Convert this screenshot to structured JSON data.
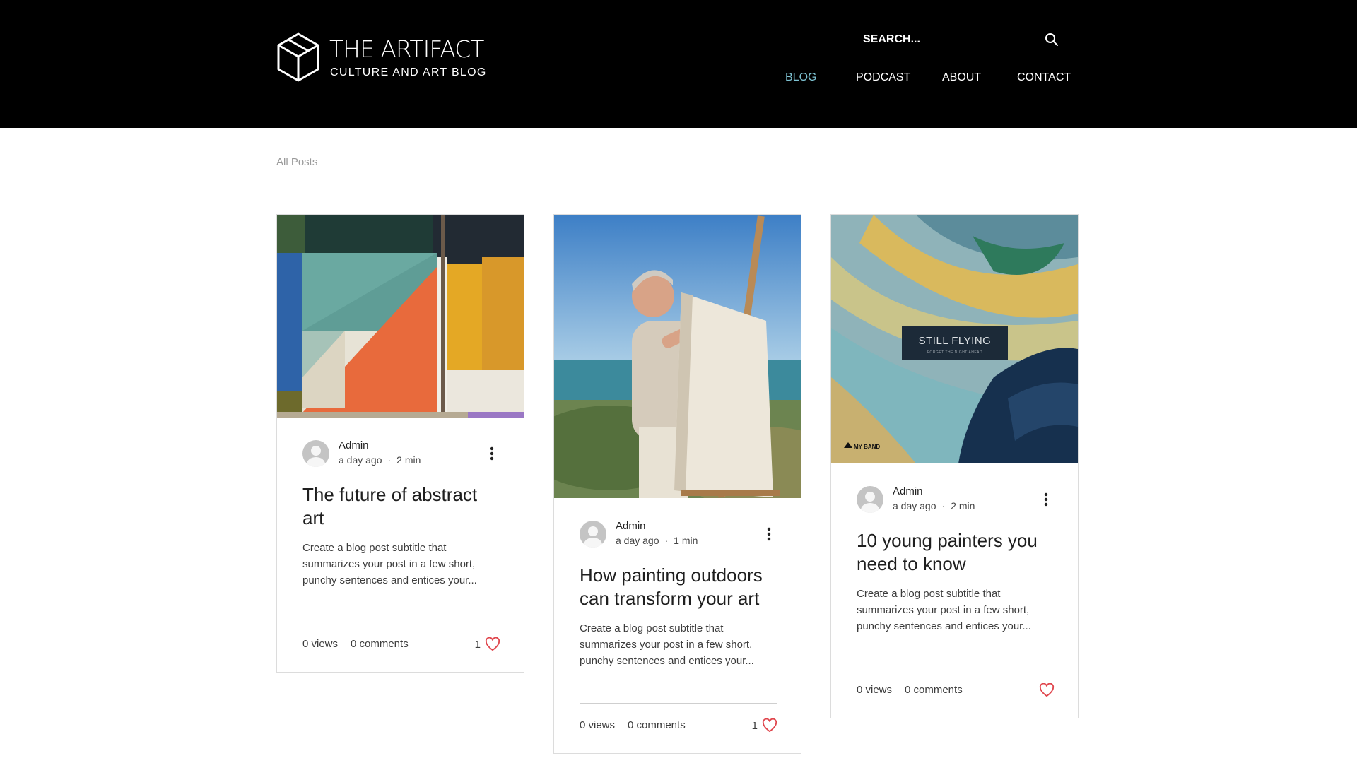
{
  "site": {
    "title": "THE ARTIFACT",
    "subtitle": "CULTURE AND ART BLOG",
    "logo_icon": "hexagon-cube-icon"
  },
  "search": {
    "placeholder": "SEARCH...",
    "icon": "search-icon"
  },
  "nav": {
    "items": [
      {
        "label": "BLOG",
        "active": true
      },
      {
        "label": "PODCAST",
        "active": false
      },
      {
        "label": "ABOUT",
        "active": false
      },
      {
        "label": "CONTACT",
        "active": false
      }
    ]
  },
  "breadcrumb": {
    "all_posts": "All Posts"
  },
  "posts": [
    {
      "author": "Admin",
      "time": "a day ago",
      "read_time": "2 min",
      "title": "The future of abstract art",
      "excerpt": "Create a blog post subtitle that summarizes your post in a few short, punchy sentences and entices your...",
      "views": "0 views",
      "comments": "0 comments",
      "likes": "1",
      "liked": false,
      "image": "abstract-painting"
    },
    {
      "author": "Admin",
      "time": "a day ago",
      "read_time": "1 min",
      "title": "How painting outdoors can transform your art",
      "excerpt": "Create a blog post subtitle that summarizes your post in a few short, punchy sentences and entices your...",
      "views": "0 views",
      "comments": "0 comments",
      "likes": "1",
      "liked": false,
      "image": "man-painting-at-easel-by-sea"
    },
    {
      "author": "Admin",
      "time": "a day ago",
      "read_time": "2 min",
      "title": "10 young painters you need to know",
      "excerpt": "Create a blog post subtitle that summarizes your post in a few short, punchy sentences and entices your...",
      "views": "0 views",
      "comments": "0 comments",
      "likes": "",
      "liked": false,
      "image": "album-cover-brushstrokes",
      "image_text": {
        "title": "STILL FLYING",
        "tagline": "FORGET THE NIGHT AHEAD",
        "brand": "MY BAND"
      }
    }
  ],
  "colors": {
    "header_bg": "#000000",
    "nav_active": "#7ec3d3",
    "heart": "#e0454c",
    "muted": "#9a9a9a"
  }
}
